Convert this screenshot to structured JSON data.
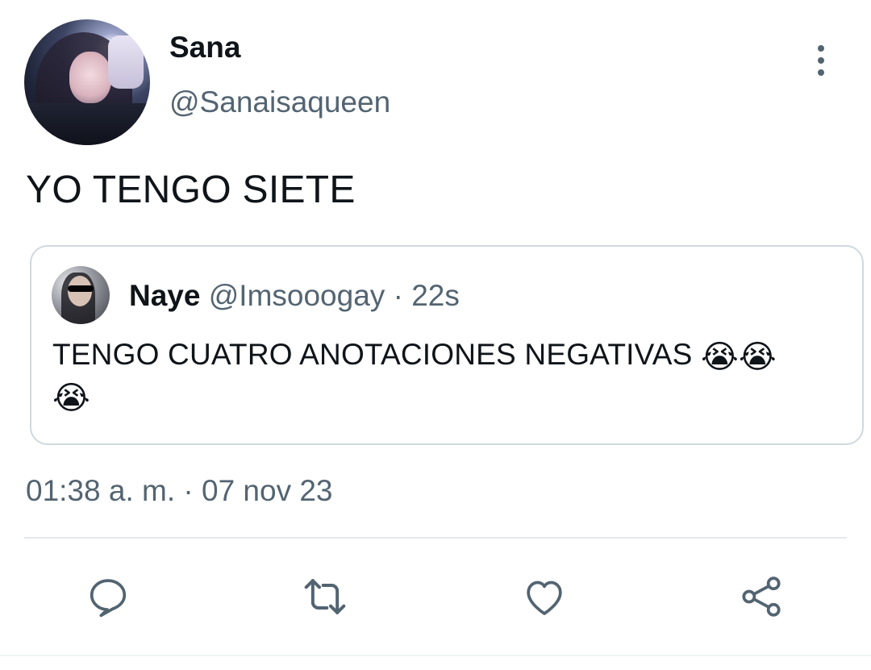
{
  "author": {
    "name": "Sana",
    "handle": "@Sanaisaqueen"
  },
  "tweet": {
    "text": "YO TENGO SIETE"
  },
  "quote": {
    "name": "Naye",
    "handle": "@Imsooogay",
    "separator": "·",
    "time": "22s",
    "text": "TENGO CUATRO ANOTACIONES NEGATIVAS",
    "emojis": [
      "😭",
      "😭",
      "😭"
    ]
  },
  "meta": {
    "timestamp": "01:38 a. m. · 07 nov 23"
  },
  "actions": [
    {
      "icon": "reply-icon"
    },
    {
      "icon": "retweet-icon"
    },
    {
      "icon": "like-icon"
    },
    {
      "icon": "share-icon"
    }
  ],
  "colors": {
    "text_primary": "#0f1419",
    "text_secondary": "#536471",
    "border": "#cfd9de",
    "icon": "#536471"
  }
}
